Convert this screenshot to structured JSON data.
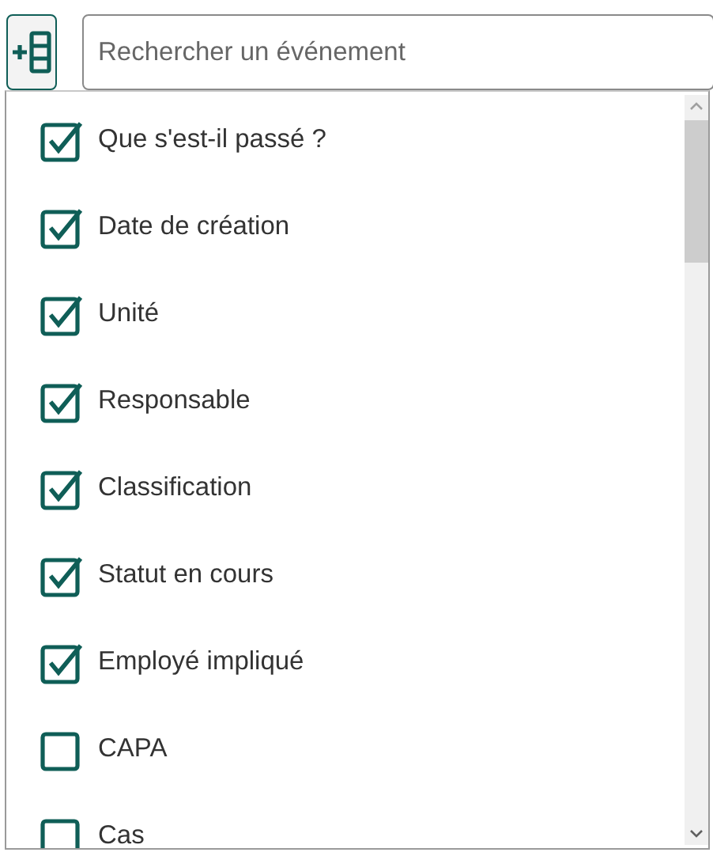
{
  "search": {
    "placeholder": "Rechercher un événement"
  },
  "columns": [
    {
      "label": "Que s'est-il passé ?",
      "checked": true
    },
    {
      "label": "Date de création",
      "checked": true
    },
    {
      "label": "Unité",
      "checked": true
    },
    {
      "label": "Responsable",
      "checked": true
    },
    {
      "label": "Classification",
      "checked": true
    },
    {
      "label": "Statut en cours",
      "checked": true
    },
    {
      "label": "Employé impliqué",
      "checked": true
    },
    {
      "label": "CAPA",
      "checked": false
    },
    {
      "label": "Cas",
      "checked": false
    }
  ]
}
